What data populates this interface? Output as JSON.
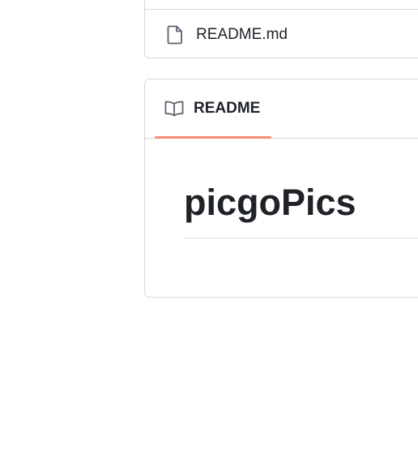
{
  "files": {
    "items": [
      {
        "name": "README.md",
        "icon": "file-icon"
      }
    ]
  },
  "readme": {
    "tab_label": "README",
    "tab_icon": "book-icon",
    "title": "picgoPics"
  },
  "colors": {
    "border": "#d1d9e0",
    "text": "#1f2328",
    "icon": "#59636e",
    "tab_underline": "#fd8c73"
  }
}
